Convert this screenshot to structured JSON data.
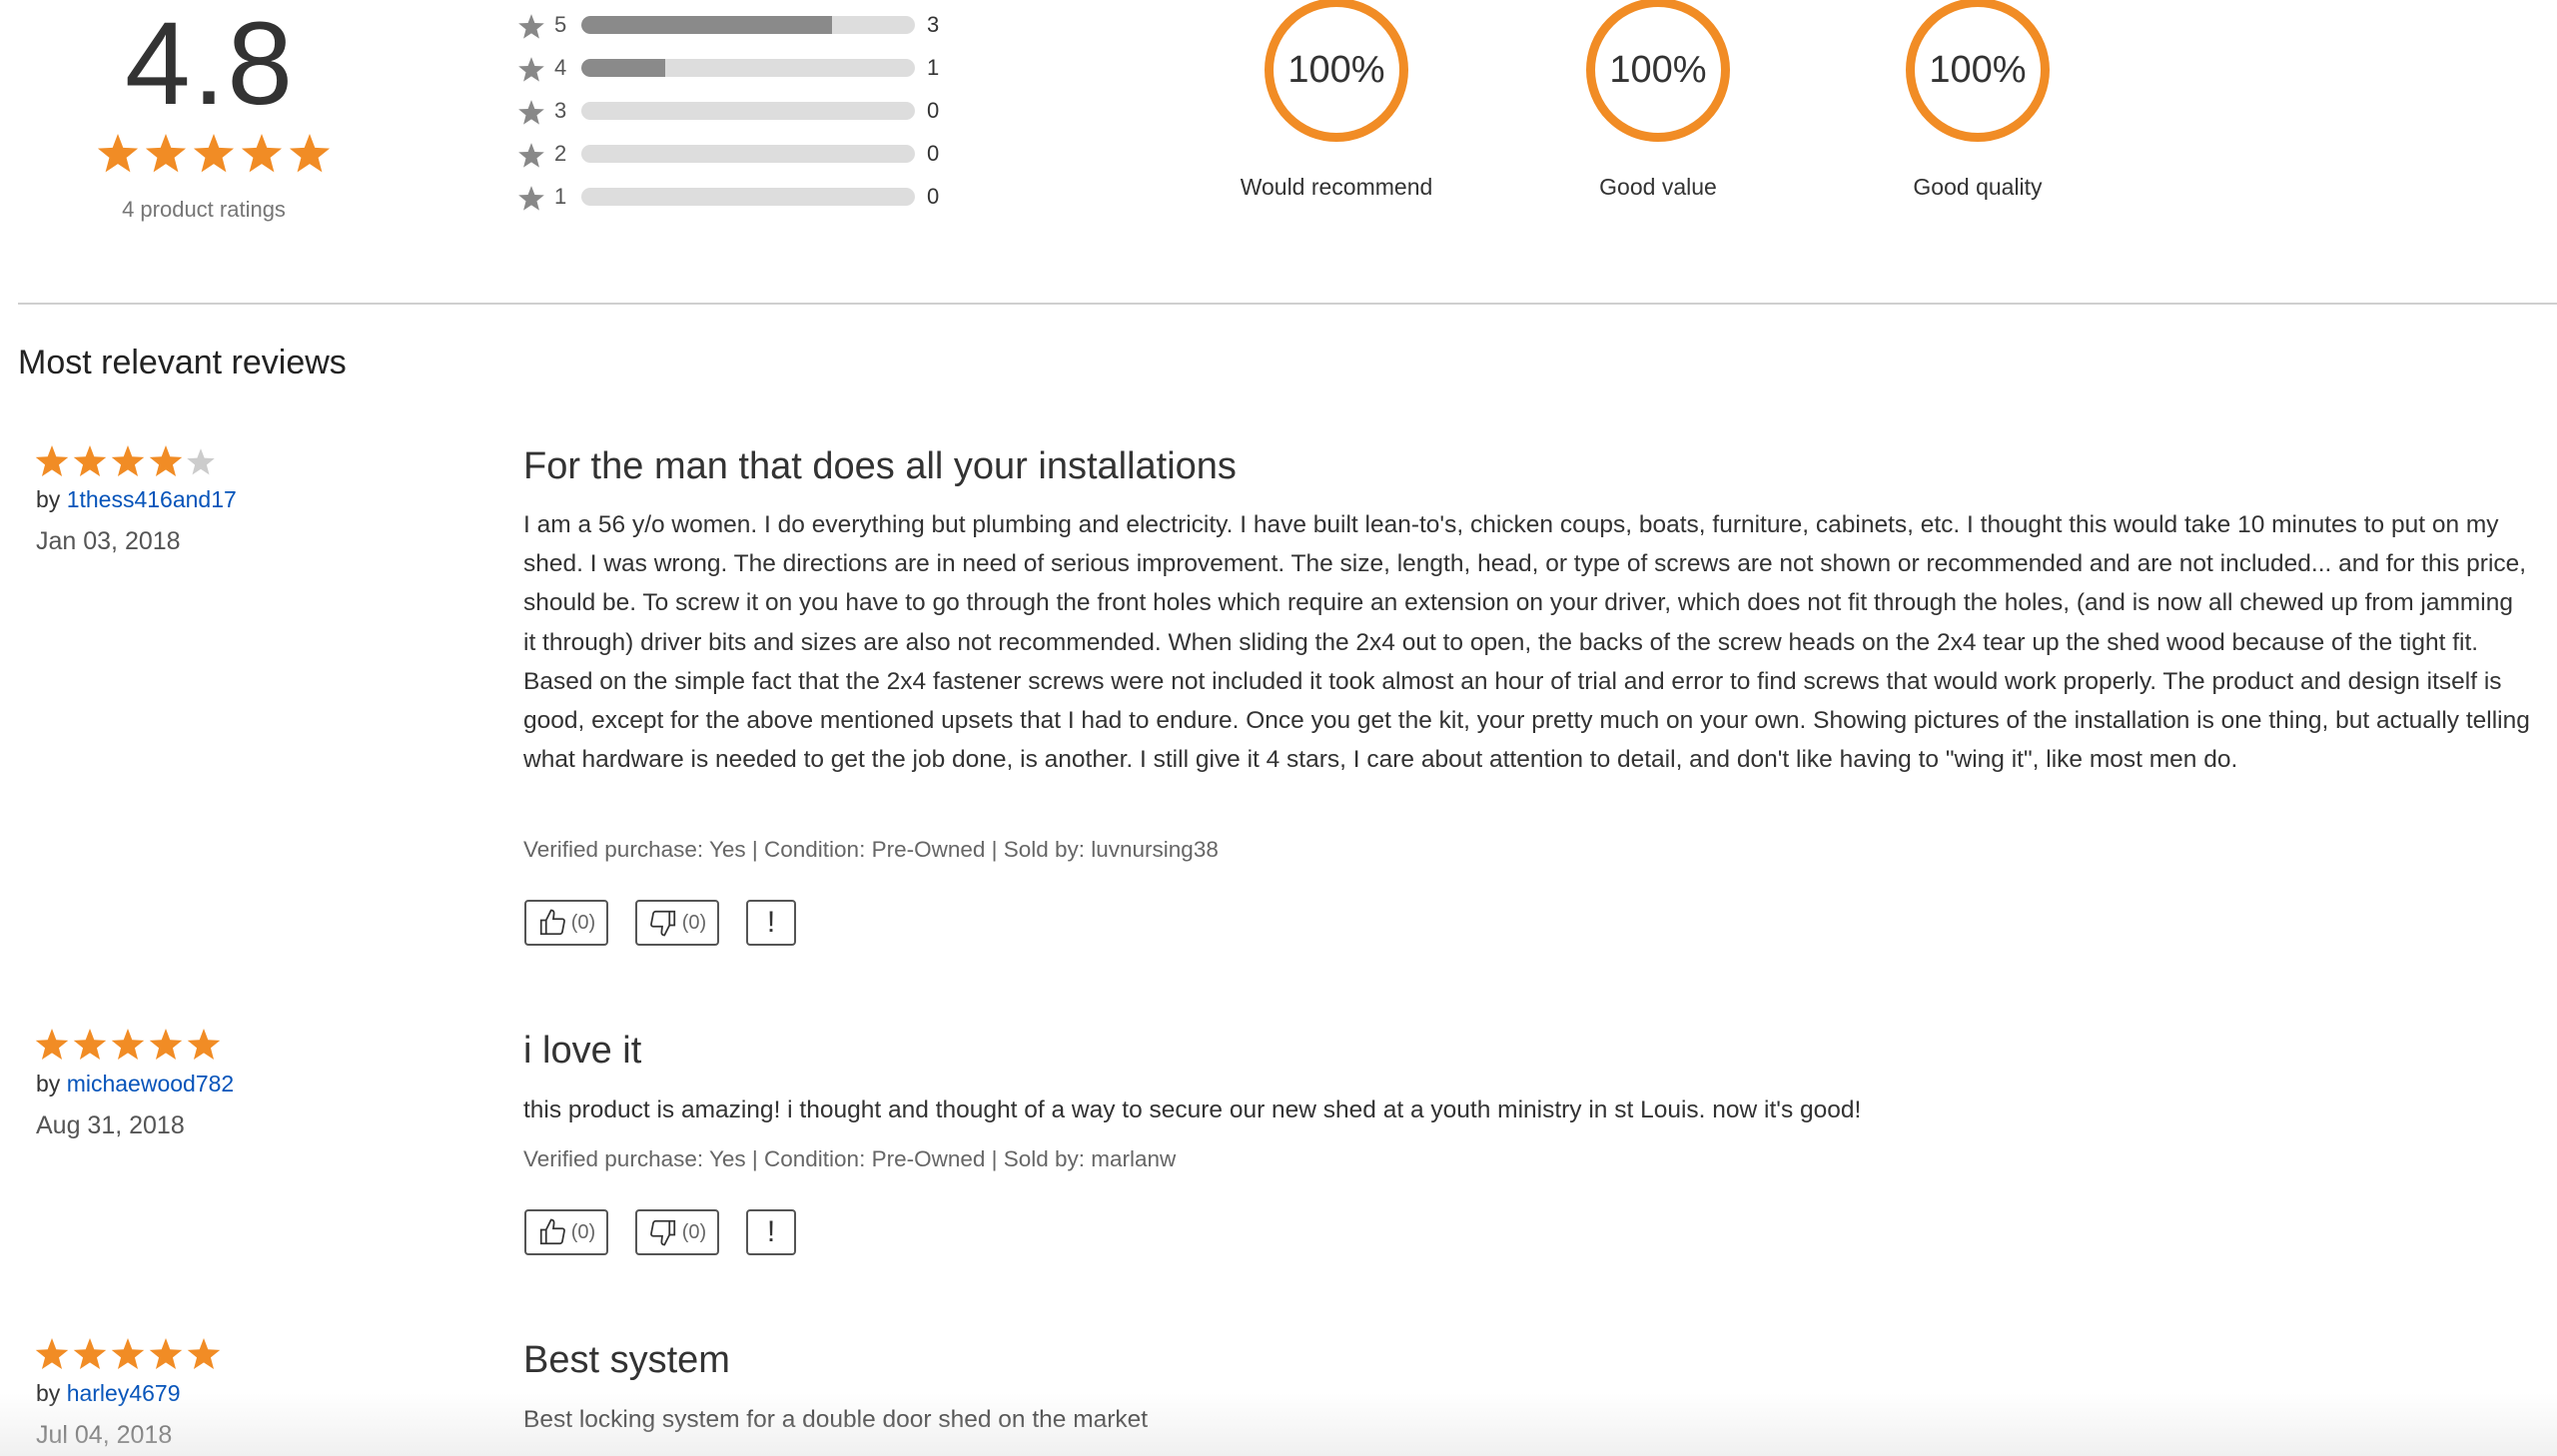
{
  "summary": {
    "average_rating": "4.8",
    "average_stars": 4.8,
    "ratings_count_text": "4 product ratings",
    "histogram": [
      {
        "stars": "5",
        "count": "3",
        "fraction": 0.75
      },
      {
        "stars": "4",
        "count": "1",
        "fraction": 0.25
      },
      {
        "stars": "3",
        "count": "0",
        "fraction": 0
      },
      {
        "stars": "2",
        "count": "0",
        "fraction": 0
      },
      {
        "stars": "1",
        "count": "0",
        "fraction": 0
      }
    ],
    "attributes": [
      {
        "percent": "100%",
        "label": "Would recommend"
      },
      {
        "percent": "100%",
        "label": "Good value"
      },
      {
        "percent": "100%",
        "label": "Good quality"
      }
    ]
  },
  "reviews_section_title": "Most relevant reviews",
  "reviews": [
    {
      "rating": 4,
      "by_prefix": "by ",
      "author": "1thess416and17",
      "date": "Jan 03, 2018",
      "title": "For the man that does all your installations",
      "body": "I am a 56 y/o women. I do everything but plumbing and electricity.  I have built lean-to's, chicken coups, boats, furniture, cabinets, etc.  I thought this would take 10 minutes to put on my shed. I was wrong. The directions are in need of serious improvement. The size, length, head, or type of screws are not shown or recommended and are not included... and for this price, should be. To screw it on you have to go through the front holes which require an extension on your driver, which does not fit through the holes, (and is now all chewed up from jamming it through) driver bits and sizes are also not recommended. When sliding the 2x4 out to open, the backs of the screw heads on the 2x4 tear up the shed wood because of the tight fit.  Based on the simple fact that the 2x4 fastener screws were not included it took almost an hour of trial and error to find screws that would work properly.  The product and design itself is good, except for the above mentioned upsets that I had to endure. Once you get the kit, your pretty much on your own.  Showing pictures of the installation is one thing, but actually telling what hardware is needed to get the job done, is another.  I still give it 4 stars, I care about attention to detail, and don't like having to \"wing it\", like most men do.",
      "meta": "Verified purchase: Yes | Condition: Pre-Owned | Sold by: luvnursing38",
      "helpful_count": "(0)",
      "unhelpful_count": "(0)",
      "report_label": "!"
    },
    {
      "rating": 5,
      "by_prefix": "by ",
      "author": "michaewood782",
      "date": "Aug 31, 2018",
      "title": "i love it",
      "body": "this product is amazing! i thought and thought of a way to secure our new shed at a youth ministry in st Louis. now it's good!",
      "meta": "Verified purchase: Yes | Condition: Pre-Owned | Sold by: marlanw",
      "helpful_count": "(0)",
      "unhelpful_count": "(0)",
      "report_label": "!"
    },
    {
      "rating": 5,
      "by_prefix": "by ",
      "author": "harley4679",
      "date": "Jul 04, 2018",
      "title": "Best system",
      "body": "Best locking system for a double door shed on the market"
    }
  ],
  "colors": {
    "star_orange": "#f18c25",
    "star_grey": "#cccccc",
    "link_blue": "#0654ba",
    "bar_fill": "#8a8a8a",
    "bar_track": "#dddddd"
  }
}
